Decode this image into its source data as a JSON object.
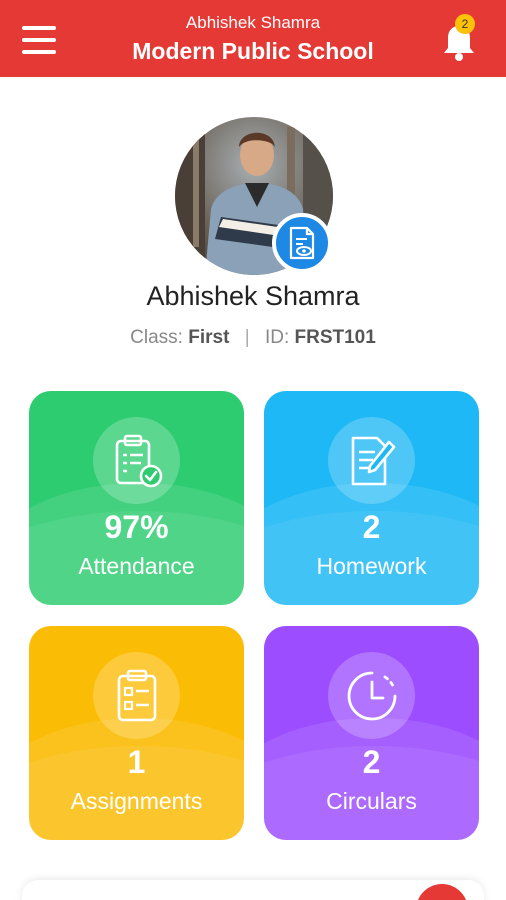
{
  "header": {
    "subtitle": "Abhishek Shamra",
    "title": "Modern Public School",
    "notification_count": "2",
    "bg_color": "#e53935"
  },
  "profile": {
    "name": "Abhishek Shamra",
    "class_label": "Class:",
    "class_value": "First",
    "separator": "|",
    "id_label": "ID:",
    "id_value": "FRST101"
  },
  "cards": [
    {
      "value": "97%",
      "label": "Attendance",
      "icon": "clipboard-check-icon",
      "color": "#2ecc71"
    },
    {
      "value": "2",
      "label": "Homework",
      "icon": "document-pen-icon",
      "color": "#1db8f5"
    },
    {
      "value": "1",
      "label": "Assignments",
      "icon": "clipboard-list-icon",
      "color": "#fbbc05"
    },
    {
      "value": "2",
      "label": "Circulars",
      "icon": "clock-icon",
      "color": "#9c4dff"
    }
  ]
}
